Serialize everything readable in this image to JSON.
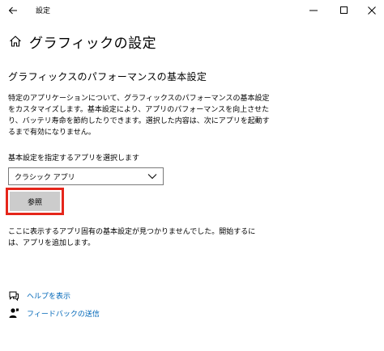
{
  "titlebar": {
    "app_title": "設定",
    "back_icon": "back-arrow-icon",
    "minimize_icon": "minimize-icon",
    "maximize_icon": "maximize-icon",
    "close_icon": "close-icon"
  },
  "page": {
    "title": "グラフィックの設定",
    "home_icon": "home-icon"
  },
  "section": {
    "heading": "グラフィックスのパフォーマンスの基本設定",
    "description": "特定のアプリケーションについて、グラフィックスのパフォーマンスの基本設定をカスタマイズします。基本設定により、アプリのパフォーマンスを向上させたり、バッテリ寿命を節約したりできます。選択した内容は、次にアプリを起動するまで有効になりません。"
  },
  "app_selector": {
    "label": "基本設定を指定するアプリを選択します",
    "selected_value": "クラシック アプリ",
    "icon": "chevron-down-icon"
  },
  "browse_button": {
    "label": "参照",
    "highlight_color": "#e5261b"
  },
  "empty_message": "ここに表示するアプリ固有の基本設定が見つかりませんでした。開始するには、アプリを追加します。",
  "links": {
    "help": {
      "label": "ヘルプを表示",
      "icon": "help-chat-icon"
    },
    "feedback": {
      "label": "フィードバックの送信",
      "icon": "feedback-person-icon"
    }
  },
  "colors": {
    "link": "#0067b8",
    "button_bg": "#cccccc",
    "highlight": "#e5261b"
  }
}
